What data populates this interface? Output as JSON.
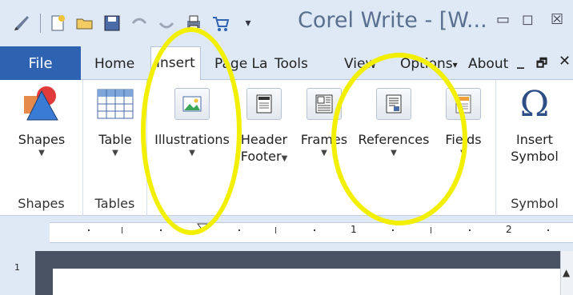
{
  "window": {
    "title": "Corel Write - [W...",
    "controls": {
      "minimize": "▭",
      "restore": "◻",
      "close": "☒"
    }
  },
  "quick_access": [
    "pen-icon",
    "new-doc-icon",
    "open-folder-icon",
    "save-icon",
    "undo-icon",
    "redo-icon",
    "print-icon",
    "cart-icon",
    "customize-arrow"
  ],
  "ribbon_tabs": [
    {
      "label": "File"
    },
    {
      "label": "Home"
    },
    {
      "label": "Insert",
      "active": true
    },
    {
      "label": "Page La"
    },
    {
      "label": "Tools"
    },
    {
      "label": "View"
    },
    {
      "label": "Options",
      "dropdown": "▾"
    },
    {
      "label": "About"
    }
  ],
  "tab_controls": {
    "minimize": "_",
    "restore": "🗗",
    "close": "✕"
  },
  "groups": {
    "shapes": {
      "label": "Shapes",
      "button": "Shapes"
    },
    "tables": {
      "label": "Tables",
      "button": "Table"
    },
    "misc": {
      "illustrations": "Illustrations",
      "header_footer": [
        "Header",
        "Footer"
      ],
      "frames": "Frames",
      "references": "References",
      "fields": "Fields"
    },
    "symbol": {
      "label": "Symbol",
      "button": [
        "Insert",
        "Symbol"
      ]
    }
  },
  "ruler": {
    "labels": [
      "1",
      "2"
    ]
  },
  "vertical_ruler": {
    "label": "1"
  },
  "colors": {
    "file_tab": "#2d63b0",
    "annotation": "#f2ef00",
    "titlebar": "#dfe9f5"
  }
}
